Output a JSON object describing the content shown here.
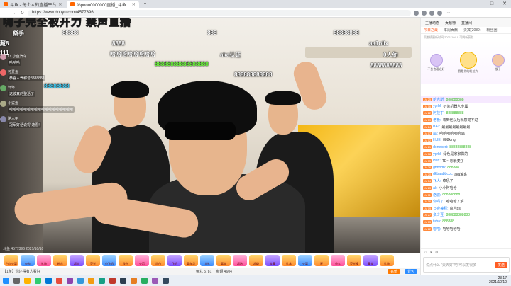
{
  "browser": {
    "tabs": [
      {
        "label": "斗鱼 - 每个人的直播平台"
      },
      {
        "label": "%pooo0000000直播_斗鱼..."
      },
      {
        "label": "+"
      }
    ],
    "url": "https://www.douyu.com/4577396",
    "window_controls": [
      "—",
      "□",
      "✕"
    ]
  },
  "video": {
    "title_watermark": "嗨子完全被开力 禁声直播",
    "danmu": [
      {
        "text": "88888"
      },
      {
        "text": "888"
      },
      {
        "text": "88888888"
      },
      {
        "text": "8888"
      },
      {
        "text": "哈哈哈哈哈哈哈哈"
      },
      {
        "text": "aka认证"
      },
      {
        "text": "88888888888888888"
      },
      {
        "text": "888888888888"
      },
      {
        "text": "8888888888"
      },
      {
        "text": "aa1olix"
      },
      {
        "text": "0人你"
      },
      {
        "text": "88888888"
      },
      {
        "text": "燊手"
      },
      {
        "text": "藏8"
      },
      {
        "text": "111"
      }
    ],
    "overlay_chat": [
      {
        "name": "Ls 小鱼汽车",
        "text": "哈哈哈"
      },
      {
        "name": "可爱鱼",
        "text": "恭喜人气称号8888888"
      },
      {
        "name": "坏坏",
        "text": "这波真的整活了"
      },
      {
        "name": "小鲨鱼",
        "text": "哈哈哈哈哈哈哈哈哈哈哈哈哈哈哈哈哈哈"
      },
      {
        "name": "路人甲",
        "text": "冠军好话说得,速看!"
      }
    ],
    "bottom_watermark": "斗鱼 4577396 2021/10/10"
  },
  "giftbar": {
    "gifts": [
      "白红火箭",
      "办卡",
      "礼物",
      "粉丝",
      "超大",
      "荧光",
      "小飞机",
      "龙舟",
      "火箭",
      "告白",
      "飞机",
      "嘉年华",
      "大礼",
      "嘉宾",
      "超跑",
      "超级",
      "宝藏",
      "礼盒",
      "火箭",
      "星",
      "鱼丸",
      "荧光棒",
      "藏宝",
      "礼物"
    ]
  },
  "infobar": {
    "left": "【1条】你还得有人看好",
    "fish": "鱼丸 5781",
    "yuchi": "鱼翅 4604",
    "charge_button": "充值",
    "bag_button": "背包"
  },
  "right_panel": {
    "top_items": [
      "主播动态",
      "贡献榜",
      "直播间"
    ],
    "tabs": [
      "今日之最",
      "本周贡献",
      "贵宾(2089)",
      "粉丝团"
    ],
    "note": "贡献榜更新时间:2021/10/10 可刷新获取",
    "rank": [
      {
        "name": "不负言语之好"
      },
      {
        "name": "我是你的粉丝大"
      },
      {
        "name": "猴子"
      }
    ],
    "chat": [
      {
        "lv": "LV 25",
        "name": "蛤吉斯:",
        "text": "888888888",
        "hl": true
      },
      {
        "lv": "LV 16",
        "name": "ygrbl:",
        "text": "奶茶机器人专属",
        "hl": false
      },
      {
        "lv": "LV 22",
        "name": "阿拉丁:",
        "text": "888888888",
        "hl": false
      },
      {
        "lv": "LV 19",
        "name": "老板:",
        "text": "收到他以后就感觉不过",
        "hl": false
      },
      {
        "lv": "LV 24",
        "name": "BAT:",
        "text": "最最最最最最最最",
        "hl": false
      },
      {
        "lv": "LV 17",
        "name": "aa:",
        "text": "哈哈哈哈哈哈aa",
        "hl": false
      },
      {
        "lv": "LV 12",
        "name": "HUE:",
        "text": "888king",
        "hl": false
      },
      {
        "lv": "LV 21",
        "name": "donebert:",
        "text": "88888888888",
        "hl": false
      },
      {
        "lv": "LV 18",
        "name": "ygrbl:",
        "text": "绿色是家家做的",
        "hl": false
      },
      {
        "lv": "LV 15",
        "name": "Hen:",
        "text": "TD~ 想长麦了",
        "hl": false
      },
      {
        "lv": "LV 26",
        "name": "gfmodb:",
        "text": "888888",
        "hl": false
      },
      {
        "lv": "LV 20",
        "name": "dkbaabbccc:",
        "text": "aka浪客",
        "hl": false
      },
      {
        "lv": "LV 14",
        "name": "飞人:",
        "text": "牵吼了",
        "hl": false
      },
      {
        "lv": "LV 23",
        "name": "ali:",
        "text": "小小阿哈哈",
        "hl": false
      },
      {
        "lv": "LV 11",
        "name": "骆驼:",
        "text": "888888888",
        "hl": false
      },
      {
        "lv": "LV 16",
        "name": "你吗了:",
        "text": "哈哈哈了解",
        "hl": false
      },
      {
        "lv": "LV 19",
        "name": "日夜兼程:",
        "text": "真人ps",
        "hl": false
      },
      {
        "lv": "LV 27",
        "name": "多少豆:",
        "text": "888888888888",
        "hl": false
      },
      {
        "lv": "LV 13",
        "name": "tuba:",
        "text": "888888",
        "hl": false
      },
      {
        "lv": "LV 22",
        "name": "喵喵:",
        "text": "哈哈哈哈哈",
        "hl": false
      }
    ],
    "input_placeholder": "说点什么 “天天好”吧,可以发很多",
    "send_button": "发送"
  },
  "taskbar": {
    "time": "23:17",
    "date": "2021/10/10"
  }
}
